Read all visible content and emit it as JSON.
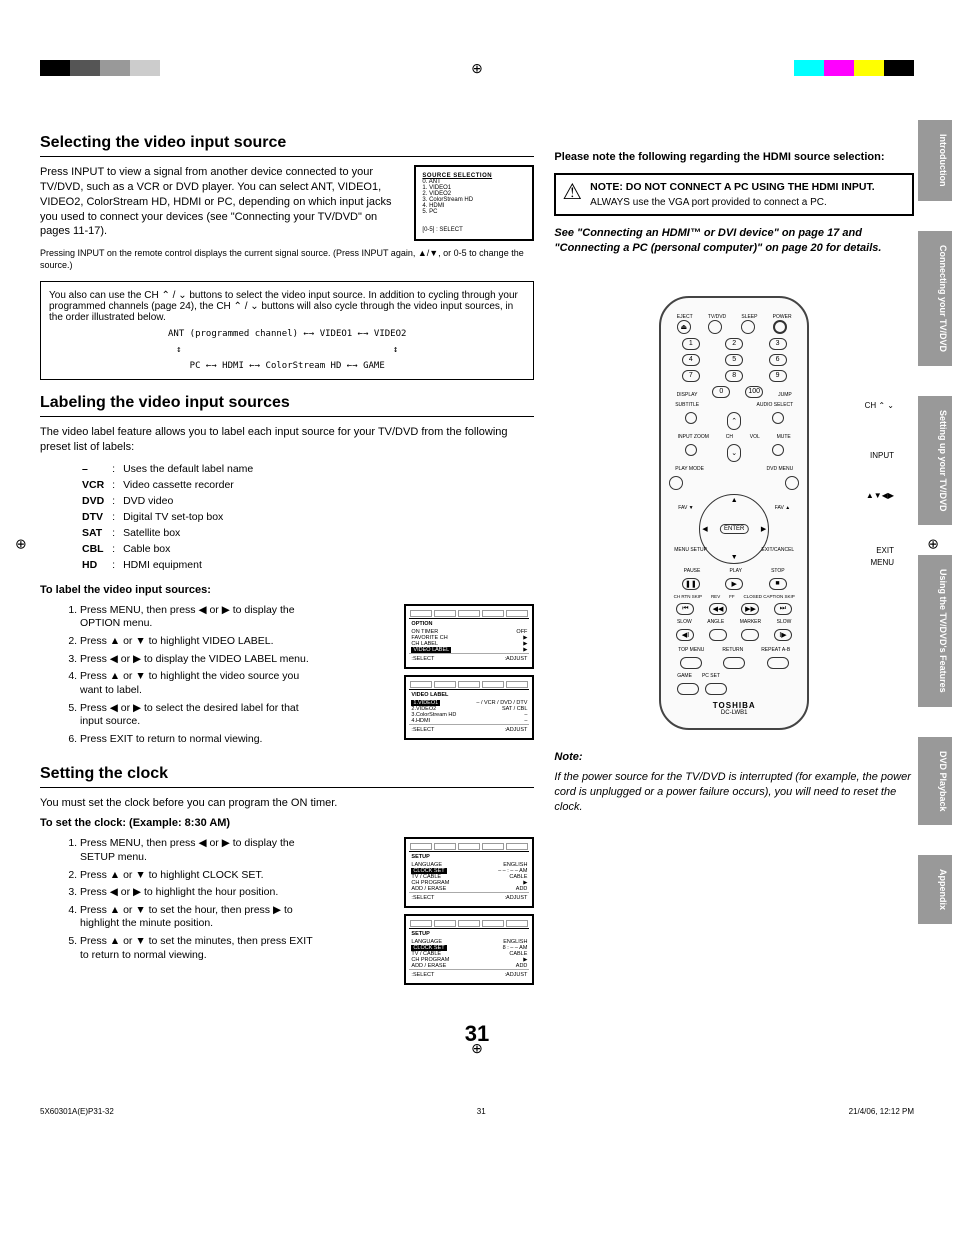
{
  "page_number": "31",
  "footer": {
    "left": "5X60301A(E)P31-32",
    "mid": "31",
    "right": "21/4/06, 12:12 PM"
  },
  "side_tabs": [
    "Introduction",
    "Connecting your TV/DVD",
    "Setting up your TV/DVD",
    "Using the TV/DVD's Features",
    "DVD Playback",
    "Appendix"
  ],
  "sec1": {
    "title": "Selecting the video input source",
    "body": "Press INPUT to view a signal from another device connected to your TV/DVD, such as a VCR or DVD player. You can select ANT, VIDEO1, VIDEO2, ColorStream HD, HDMI or PC, depending on which input jacks you used to connect your devices (see \"Connecting your TV/DVD\" on pages 11-17).",
    "menu": {
      "title": "SOURCE SELECTION",
      "items": [
        "0. ANT",
        "1. VIDEO1",
        "2. VIDEO2",
        "3. ColorStream HD",
        "4. HDMI",
        "5. PC"
      ],
      "footer": "[0-5] : SELECT"
    },
    "caption": "Pressing INPUT on the remote control displays the current signal source. (Press INPUT again, ▲/▼, or 0-5 to change the source.)",
    "infobox": {
      "text": "You also can use the CH ⌃ / ⌄ buttons to select the video input source. In addition to cycling through your programmed channels (page 24), the CH ⌃ / ⌄ buttons will also cycle through the video input sources, in the order illustrated below.",
      "diagram1": "ANT (programmed channel) ←→ VIDEO1 ←→ VIDEO2",
      "diagram2": "PC ←→ HDMI ←→ ColorStream HD ←→ GAME"
    }
  },
  "sec2": {
    "title": "Labeling the video input sources",
    "intro": "The video label feature allows you to label each input source for your TV/DVD from the following preset list of labels:",
    "labels": [
      [
        "–",
        "Uses the default label name"
      ],
      [
        "VCR",
        "Video cassette recorder"
      ],
      [
        "DVD",
        "DVD video"
      ],
      [
        "DTV",
        "Digital TV set-top box"
      ],
      [
        "SAT",
        "Satellite box"
      ],
      [
        "CBL",
        "Cable box"
      ],
      [
        "HD",
        "HDMI equipment"
      ]
    ],
    "subhead": "To label the video input sources:",
    "steps": [
      "Press MENU, then press ◀ or ▶ to display the OPTION menu.",
      "Press ▲ or ▼ to highlight VIDEO LABEL.",
      "Press ◀ or ▶ to display the VIDEO LABEL menu.",
      "Press ▲ or ▼ to highlight the video source you want to label.",
      "Press ◀ or ▶ to select the desired label for that input source.",
      "Press EXIT to return to normal viewing."
    ],
    "menu1": {
      "hdr": "OPTION",
      "rows": [
        [
          "ON TIMER",
          "OFF"
        ],
        [
          "FAVORITE CH",
          "▶"
        ],
        [
          "CH LABEL",
          "▶"
        ],
        [
          "VIDEO LABEL",
          "▶"
        ]
      ],
      "sel": ":SELECT",
      "adj": ":ADJUST"
    },
    "menu2": {
      "hdr": "VIDEO LABEL",
      "rows": [
        [
          "1.VIDEO1",
          "– / VCR / DVD / DTV"
        ],
        [
          "2.VIDEO2",
          "SAT / CBL"
        ],
        [
          "3.ColorStream HD",
          "–"
        ],
        [
          "4.HDMI",
          "–"
        ]
      ],
      "sel": ":SELECT",
      "adj": ":ADJUST"
    }
  },
  "sec3": {
    "title": "Setting the clock",
    "intro": "You must set the clock before you can program the ON timer.",
    "subhead": "To set the clock: (Example: 8:30 AM)",
    "steps": [
      "Press MENU, then press ◀ or ▶ to display the SETUP menu.",
      "Press ▲ or ▼ to highlight CLOCK SET.",
      "Press ◀ or ▶ to highlight the hour position.",
      "Press ▲ or ▼ to set the hour, then press ▶ to highlight the minute position.",
      "Press ▲ or ▼ to set the minutes, then press EXIT to return to normal viewing."
    ],
    "menu1": {
      "hdr": "SETUP",
      "rows": [
        [
          "LANGUAGE",
          "ENGLISH"
        ],
        [
          "CLOCK SET",
          "– – : – – AM"
        ],
        [
          "TV / CABLE",
          "CABLE"
        ],
        [
          "CH PROGRAM",
          "▶"
        ],
        [
          "ADD / ERASE",
          "ADD"
        ]
      ],
      "sel": ":SELECT",
      "adj": ":ADJUST"
    },
    "menu2": {
      "hdr": "SETUP",
      "rows": [
        [
          "LANGUAGE",
          "ENGLISH"
        ],
        [
          "CLOCK SET",
          "8 : – – AM"
        ],
        [
          "TV / CABLE",
          "CABLE"
        ],
        [
          "CH PROGRAM",
          "▶"
        ],
        [
          "ADD / ERASE",
          "ADD"
        ]
      ],
      "sel": ":SELECT",
      "adj": ":ADJUST"
    }
  },
  "rightcol": {
    "lead": "Please note the following regarding the HDMI source selection:",
    "warn_head": "NOTE: DO NOT CONNECT A PC USING THE HDMI INPUT.",
    "warn_body": "ALWAYS use the VGA port provided to connect a PC.",
    "see": "See \"Connecting an HDMI™ or DVI device\" on page 17 and \"Connecting a PC (personal computer)\" on page 20 for details.",
    "note_head": "Note:",
    "note_body": "If the power source for the TV/DVD is interrupted (for example, the power cord is unplugged or a power failure occurs), you will need to reset the clock.",
    "remote": {
      "annotations": [
        "CH ⌃ ⌄",
        "INPUT",
        "▲▼◀▶",
        "EXIT",
        "MENU"
      ],
      "toprow": [
        "EJECT",
        "TV/DVD",
        "SLEEP",
        "POWER"
      ],
      "nums": [
        "1",
        "2",
        "3",
        "4",
        "5",
        "6",
        "7",
        "8",
        "9",
        "0",
        "100"
      ],
      "display": "DISPLAY",
      "jump": "JUMP",
      "midlabels": [
        "SUBTITLE",
        "AUDIO SELECT",
        "INPUT ZOOM",
        "CH",
        "VOL",
        "MUTE",
        "PLAY MODE",
        "DVD MENU"
      ],
      "sides": [
        "FAV ▼",
        "FAV ▲",
        "MENU SETUP",
        "EXIT/CANCEL"
      ],
      "enter": "ENTER",
      "trans": [
        "PAUSE",
        "PLAY",
        "STOP",
        "CH RTN SKIP",
        "REV",
        "FF",
        "CLOSED CAPTION SKIP",
        "SLOW",
        "ANGLE",
        "MARKER",
        "SLOW"
      ],
      "bot": [
        "TOP MENU",
        "RETURN",
        "REPEAT A-B",
        "GAME",
        "PC SET"
      ],
      "brand": "TOSHIBA",
      "model": "DC-LWB1"
    }
  }
}
